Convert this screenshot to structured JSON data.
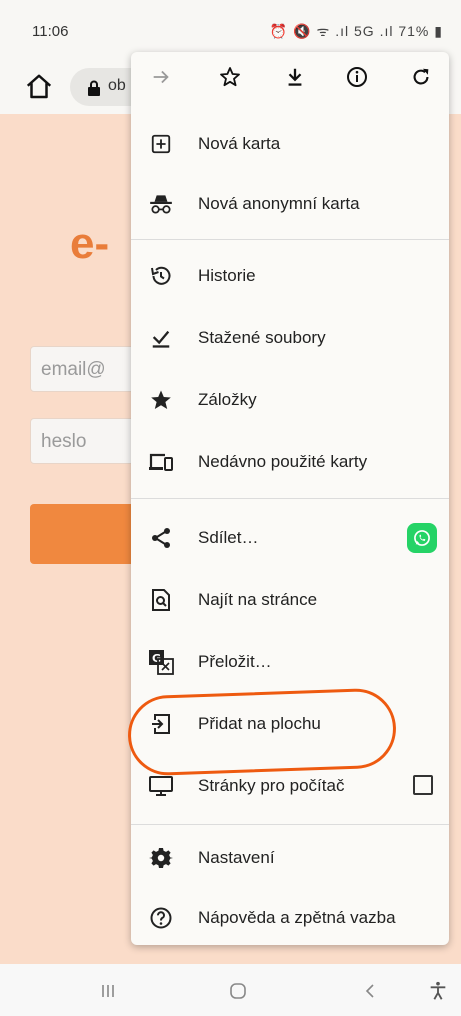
{
  "status_bar": {
    "time": "11:06",
    "icons_text": "⏰ 🔇 ᯤ .ıl 5G .ıl",
    "battery": "71%"
  },
  "toolbar": {
    "url_text": "ob",
    "home_icon": "home-icon",
    "lock_icon": "lock-icon"
  },
  "page": {
    "brand": "e-",
    "email_placeholder": "email@",
    "password_placeholder": "heslo",
    "accent_color": "#f0883f",
    "background_color": "#fadcc9"
  },
  "menu": {
    "top_icons": [
      "forward-arrow-icon",
      "star-icon",
      "download-icon",
      "info-icon",
      "reload-icon"
    ],
    "items": [
      {
        "label": "Nová karta",
        "icon": "new-tab-icon"
      },
      {
        "label": "Nová anonymní karta",
        "icon": "incognito-icon"
      },
      {
        "label": "Historie",
        "icon": "history-icon"
      },
      {
        "label": "Stažené soubory",
        "icon": "downloads-icon"
      },
      {
        "label": "Záložky",
        "icon": "bookmarks-star-icon"
      },
      {
        "label": "Nedávno použité karty",
        "icon": "recent-tabs-icon"
      },
      {
        "label": "Sdílet…",
        "icon": "share-icon"
      },
      {
        "label": "Najít na stránce",
        "icon": "find-in-page-icon"
      },
      {
        "label": "Přeložit…",
        "icon": "translate-icon"
      },
      {
        "label": "Přidat na plochu",
        "icon": "add-to-home-icon"
      },
      {
        "label": "Stránky pro počítač",
        "icon": "desktop-icon"
      },
      {
        "label": "Nastavení",
        "icon": "settings-gear-icon"
      },
      {
        "label": "Nápověda a zpětná vazba",
        "icon": "help-icon"
      }
    ],
    "desktop_checked": false,
    "highlight_color": "#ee5a10"
  },
  "nav_bar": {
    "icons": [
      "recent-apps-icon",
      "home-circle-icon",
      "back-icon",
      "accessibility-icon"
    ]
  }
}
